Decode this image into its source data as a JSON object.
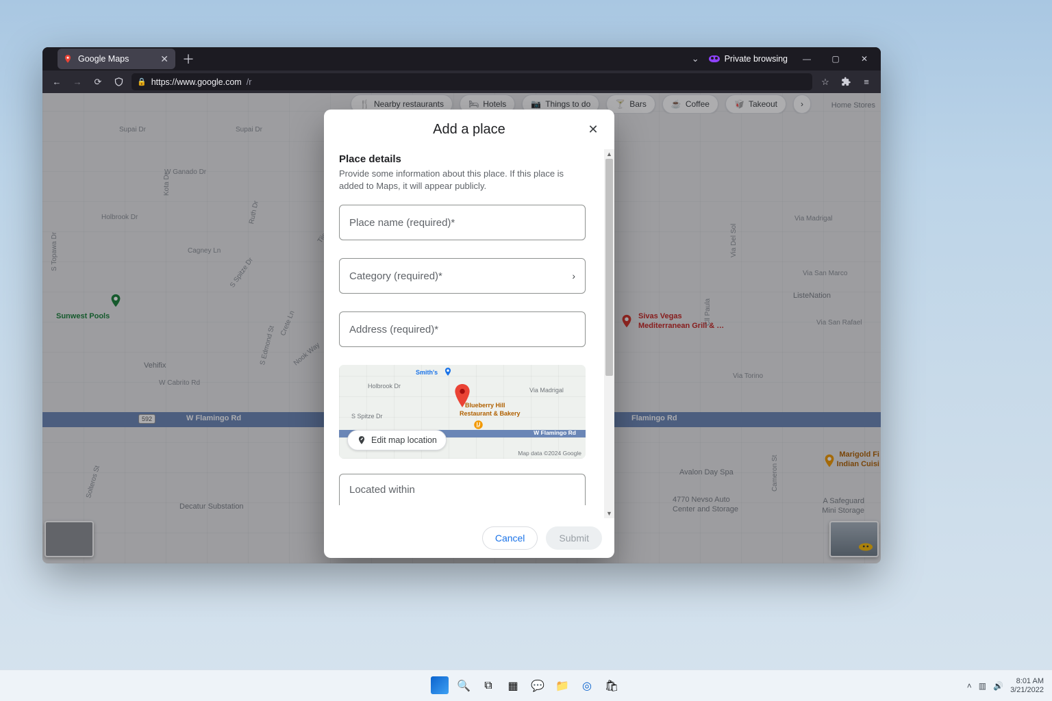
{
  "browser": {
    "tab_title": "Google Maps",
    "private_label": "Private browsing",
    "url_host": "https://www.google.com",
    "url_path": "/r"
  },
  "chips": [
    {
      "icon": "🍴",
      "label": "Nearby restaurants"
    },
    {
      "icon": "🛏",
      "label": "Hotels"
    },
    {
      "icon": "📷",
      "label": "Things to do"
    },
    {
      "icon": "🍸",
      "label": "Bars"
    },
    {
      "icon": "☕",
      "label": "Coffee"
    },
    {
      "icon": "🥡",
      "label": "Takeout"
    }
  ],
  "map_labels": {
    "road_shield": "592",
    "road_name_left": "W Flamingo Rd",
    "road_name_right": "Flamingo Rd",
    "home_stores": "Home Stores",
    "poi_sunwest": "Sunwest Pools",
    "poi_vehifix": "Vehifix",
    "poi_decatur": "Decatur Substation",
    "poi_listenation": "ListeNation",
    "poi_sivas1": "Sivas Vegas",
    "poi_sivas2": "Mediterranean Grill & …",
    "poi_avalon": "Avalon Day Spa",
    "poi_nevso1": "4770 Nevso Auto",
    "poi_nevso2": "Center and Storage",
    "poi_safeguard1": "A Safeguard",
    "poi_safeguard2": "Mini Storage",
    "poi_marigold1": "Marigold Fi",
    "poi_marigold2": "Indian Cuisi",
    "st_supai": "Supai Dr",
    "st_supai2": "Supai Dr",
    "st_ganado": "W Ganado Dr",
    "st_holbrook": "Holbrook Dr",
    "st_cagney": "Cagney Ln",
    "st_topawa": "S Topawa Dr",
    "st_kota": "Kota Dr",
    "st_ruth": "Ruth Dr",
    "st_spitze": "S Spitze Dr",
    "st_edmond": "S Edmond St",
    "st_crete": "Crete Ln",
    "st_nookway": "Nook Way",
    "st_tijeras": "Tijeras Ave",
    "st_cabrito": "W Cabrito Rd",
    "st_via_madrigal": "Via Madrigal",
    "st_via_delsol": "Via Del Sol",
    "st_via_sanmarco": "Via San Marco",
    "st_via_sanrafael": "Via San Rafael",
    "st_via_torino": "Via Torino",
    "st_cll_paula": "Cll Paula",
    "st_cameron": "Cameron St",
    "st_solteros": "Solteros St"
  },
  "modal": {
    "title": "Add a place",
    "section_title": "Place details",
    "section_desc": "Provide some information about this place. If this place is added to Maps, it will appear publicly.",
    "place_name_ph": "Place name (required)*",
    "category_ph": "Category (required)*",
    "address_ph": "Address (required)*",
    "located_within_ph": "Located within",
    "edit_location": "Edit map location",
    "cancel": "Cancel",
    "submit": "Submit"
  },
  "minimap": {
    "smiths": "Smith's",
    "holbrook": "Holbrook Dr",
    "spitze": "S Spitze Dr",
    "via_madrigal": "Via Madrigal",
    "blueberry1": "Blueberry Hill",
    "blueberry2": "Restaurant & Bakery",
    "road": "W Flamingo Rd",
    "attrib": "Map data ©2024 Google"
  },
  "system": {
    "time": "8:01 AM",
    "date": "3/21/2022"
  }
}
